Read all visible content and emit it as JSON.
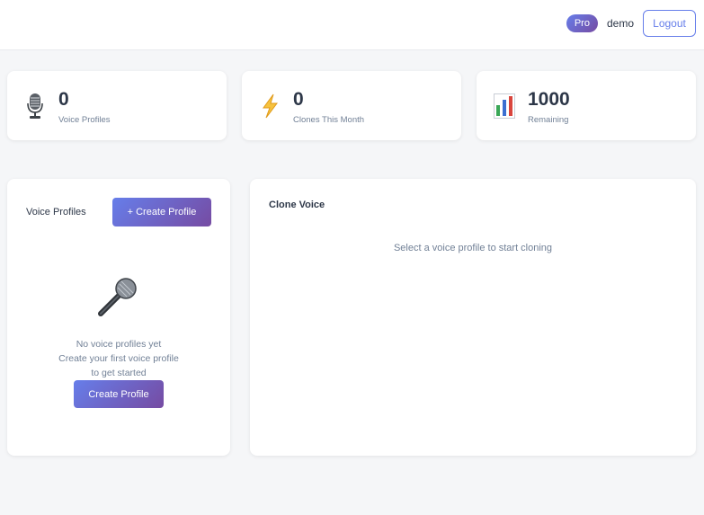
{
  "header": {
    "plan_badge": "Pro",
    "username": "demo",
    "logout_label": "Logout"
  },
  "stats": [
    {
      "icon": "studio-microphone-icon",
      "value": "0",
      "label": "Voice Profiles"
    },
    {
      "icon": "lightning-bolt-icon",
      "value": "0",
      "label": "Clones This Month"
    },
    {
      "icon": "bar-chart-icon",
      "value": "1000",
      "label": "Remaining"
    }
  ],
  "profiles_panel": {
    "title": "Voice Profiles",
    "create_label": "+ Create Profile",
    "empty_icon": "microphone-icon",
    "empty_line1": "No voice profiles yet",
    "empty_line2": "Create your first voice profile",
    "empty_line3": "to get started",
    "empty_cta": "Create Profile"
  },
  "clone_panel": {
    "title": "Clone Voice",
    "hint": "Select a voice profile to start cloning"
  },
  "colors": {
    "accent_start": "#667eea",
    "accent_end": "#764ba2",
    "background": "#f5f6f8"
  }
}
